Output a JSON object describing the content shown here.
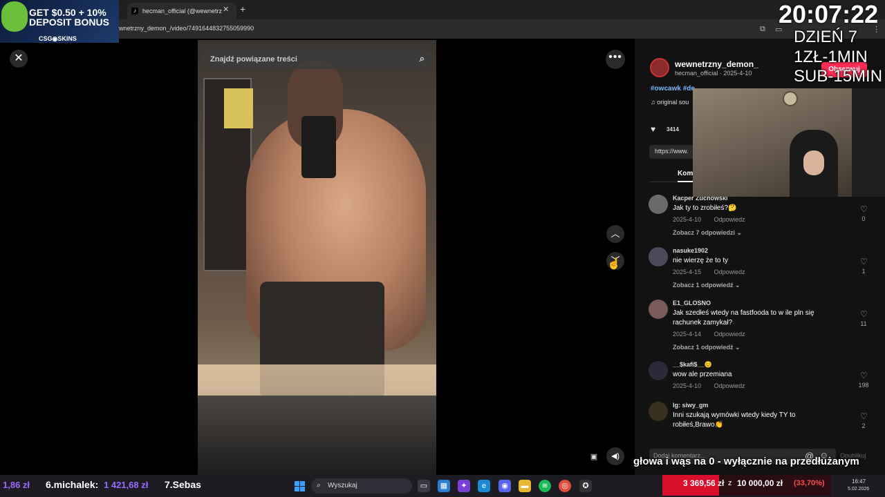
{
  "browser": {
    "tab_title": "hecman_official (@wewnetrz",
    "tab_favicon": "♪",
    "url": "wnetrzny_demon_/video/7491644832755059990"
  },
  "video": {
    "search_placeholder": "Znajdź powiązane treści"
  },
  "author": {
    "name": "wewnetrzny_demon_",
    "subline": "hecman_official · 2025-4-10",
    "follow_label": "Obserwuj"
  },
  "post": {
    "hashtags": "#owcawk #de",
    "music": "♫  original sou",
    "likes": "3414",
    "link": "https://www.",
    "comments_tab": "Kom"
  },
  "comments": [
    {
      "user": "Kacper Zuchowski",
      "text": "Jak ty to zrobiłeś?🤔",
      "date": "2025-4-10",
      "reply": "Odpowiedz",
      "replies": "Zobacz 7 odpowiedzi ⌄",
      "likes": "0"
    },
    {
      "user": "nasuke1902",
      "text": "nie wierzę że to ty",
      "date": "2025-4-15",
      "reply": "Odpowiedz",
      "replies": "Zobacz 1 odpowiedź ⌄",
      "likes": "1"
    },
    {
      "user": "E1_GLOSNO",
      "text": "Jak szedłeś wtedy na fastfooda to w ile pln się rachunek zamykał?",
      "date": "2025-4-14",
      "reply": "Odpowiedz",
      "replies": "Zobacz 1 odpowiedź ⌄",
      "likes": "11"
    },
    {
      "user": "__$kafi$__😊",
      "text": "wow ale przemiana",
      "date": "2025-4-10",
      "reply": "Odpowiedz",
      "replies": "",
      "likes": "198"
    },
    {
      "user": "Ig: siwy_gm",
      "text": "Inni szukają wymówki wtedy kiedy TY to robiłeś,Brawo👏",
      "date": "",
      "reply": "",
      "replies": "",
      "likes": "2"
    }
  ],
  "comment_input": {
    "placeholder": "Dodaj komentarz...",
    "publish_label": "Opublikuj"
  },
  "overlay": {
    "promo_line1": "GET $0.50 + 10%",
    "promo_line2": "DEPOSIT BONUS",
    "promo_brand": "CSG◉SKINS",
    "clock": "20:07:22",
    "stream_lines": [
      "DZIEŃ 7",
      "1ZŁ-1MIN",
      "SUB-15MIN"
    ],
    "banner": "głowa i wąs na 0 - wyłącznie na przedłużanym"
  },
  "taskbar": {
    "donation_1": "1,86 zł",
    "donor_2": "6.michalek:",
    "donation_2": "1 421,68 zł",
    "donor_3": "7.Sebas",
    "search_label": "Wyszukaj",
    "goal_current": "3 369,56 zł",
    "goal_sep": "z",
    "goal_target": "10 000,00 zł",
    "goal_pct": "(33,70%)",
    "goal_fraction": 0.337,
    "time": "16:47",
    "date": "5.02.2026"
  }
}
